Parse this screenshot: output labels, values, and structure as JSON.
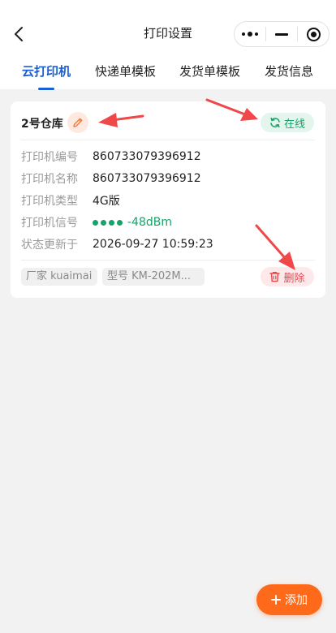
{
  "header": {
    "title": "打印设置"
  },
  "tabs": [
    {
      "label": "云打印机",
      "active": true
    },
    {
      "label": "快递单模板",
      "active": false
    },
    {
      "label": "发货单模板",
      "active": false
    },
    {
      "label": "发货信息",
      "active": false
    }
  ],
  "printer": {
    "name": "2号仓库",
    "status": "在线",
    "fields": [
      {
        "label": "打印机编号",
        "value": "860733079396912"
      },
      {
        "label": "打印机名称",
        "value": "860733079396912"
      },
      {
        "label": "打印机类型",
        "value": "4G版"
      },
      {
        "label": "打印机信号",
        "value": "-48dBm"
      },
      {
        "label": "状态更新于",
        "value": "2026-09-27 10:59:23"
      }
    ],
    "manufacturer": "厂家 kuaimai",
    "model": "型号 KM-202M...",
    "delete_label": "删除"
  },
  "add_label": "添加",
  "colors": {
    "accent": "#1a5fd6",
    "online": "#17a26a",
    "danger": "#e5484d",
    "add": "#ff6a1a",
    "annotation": "#f0474a"
  },
  "icons": [
    "back-icon",
    "more-icon",
    "minimize-icon",
    "close-target-icon",
    "edit-icon",
    "refresh-icon",
    "trash-icon",
    "plus-icon"
  ]
}
